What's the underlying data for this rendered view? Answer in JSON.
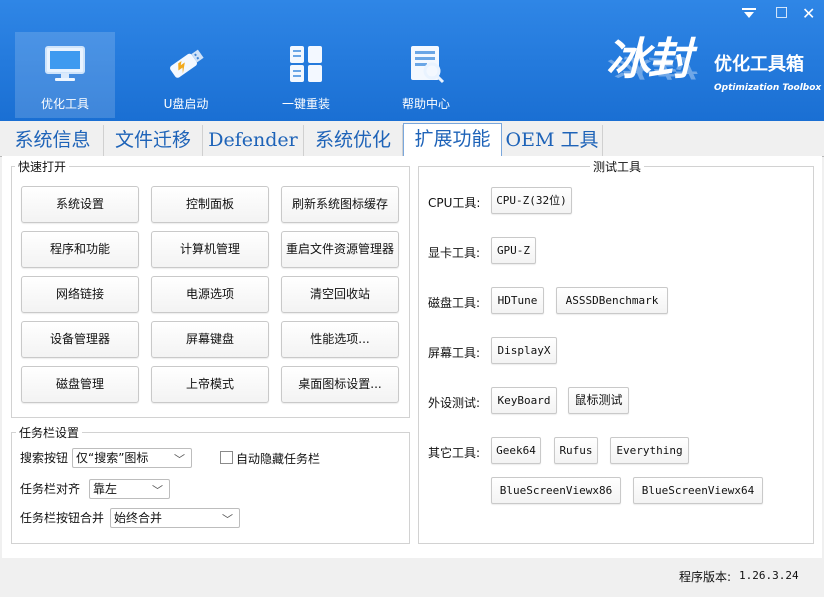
{
  "window": {
    "minimize_icon": "minimize-icon",
    "restore_label": "□",
    "close_label": "✕"
  },
  "nav": [
    {
      "label": "优化工具",
      "icon": "monitor-icon",
      "active": true
    },
    {
      "label": "U盘启动",
      "icon": "usb-drive-icon",
      "active": false
    },
    {
      "label": "一键重装",
      "icon": "windows-logo-icon",
      "active": false
    },
    {
      "label": "帮助中心",
      "icon": "help-document-icon",
      "active": false
    }
  ],
  "brand": {
    "logo_text": "冰封",
    "name": "优化工具箱",
    "subtitle": "Optimization Toolbox"
  },
  "tabs": [
    {
      "label": "系统信息",
      "active": false
    },
    {
      "label": "文件迁移",
      "active": false
    },
    {
      "label": "Defender",
      "active": false
    },
    {
      "label": "系统优化",
      "active": false
    },
    {
      "label": "扩展功能",
      "active": true
    },
    {
      "label": "OEM 工具",
      "active": false
    }
  ],
  "quick_open": {
    "title": "快速打开",
    "buttons": [
      [
        "系统设置",
        "控制面板",
        "刷新系统图标缓存"
      ],
      [
        "程序和功能",
        "计算机管理",
        "重启文件资源管理器"
      ],
      [
        "网络链接",
        "电源选项",
        "清空回收站"
      ],
      [
        "设备管理器",
        "屏幕键盘",
        "性能选项..."
      ],
      [
        "磁盘管理",
        "上帝模式",
        "桌面图标设置..."
      ]
    ]
  },
  "taskbar": {
    "title": "任务栏设置",
    "search_label": "搜索按钮",
    "search_value": "仅“搜索”图标",
    "autohide_label": "自动隐藏任务栏",
    "autohide_checked": false,
    "align_label": "任务栏对齐",
    "align_value": "靠左",
    "combine_label": "任务栏按钮合并",
    "combine_value": "始终合并"
  },
  "test_tools": {
    "title": "测试工具",
    "rows": [
      {
        "label": "CPU工具:",
        "buttons": [
          "CPU-Z(32位)"
        ]
      },
      {
        "label": "显卡工具:",
        "buttons": [
          "GPU-Z"
        ]
      },
      {
        "label": "磁盘工具:",
        "buttons": [
          "HDTune",
          "ASSSDBenchmark"
        ]
      },
      {
        "label": "屏幕工具:",
        "buttons": [
          "DisplayX"
        ]
      },
      {
        "label": "外设测试:",
        "buttons": [
          "KeyBoard",
          "鼠标测试"
        ]
      },
      {
        "label": "其它工具:",
        "buttons": [
          "Geek64",
          "Rufus",
          "Everything"
        ]
      }
    ],
    "extra_buttons": [
      "BlueScreenViewx86",
      "BlueScreenViewx64"
    ]
  },
  "footer": {
    "version_label": "程序版本:",
    "version_value": "1.26.3.24"
  }
}
